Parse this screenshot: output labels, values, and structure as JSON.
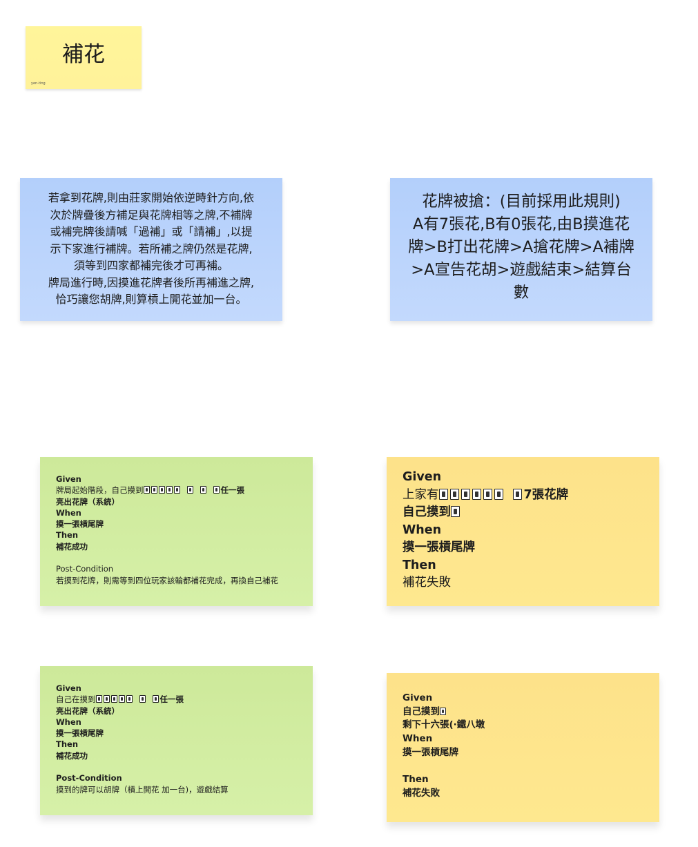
{
  "title_note": {
    "title": "補花",
    "author": "yen-ting"
  },
  "rule_notes": [
    {
      "lines": [
        "若拿到花牌,則由莊家開始依逆時針方向,依",
        "次於牌疊後方補足與花牌相等之牌,不補牌",
        "或補完牌後請喊「過補」或「請補」,以提",
        "示下家進行補牌。若所補之牌仍然是花牌,",
        "須等到四家都補完後才可再補。",
        "牌局進行時,因摸進花牌者後所再補進之牌,",
        "恰巧讓您胡牌,則算槓上開花並加一台。"
      ]
    },
    {
      "lines": [
        "花牌被搶：(目前採用此規則)",
        "A有7張花,B有0張花,由B摸進花",
        "牌>B打出花牌>A搶花牌>A補牌",
        ">A宣告花胡>遊戲結束>結算台",
        "數"
      ]
    }
  ],
  "gwt_notes": [
    {
      "given": "Given",
      "given_pre": "牌局起始階段，自己摸到",
      "given_post": "任一張",
      "given_2": "亮出花牌（系統）",
      "when": "When",
      "when_text": "摸一張槓尾牌",
      "then": "Then",
      "then_text": "補花成功",
      "post": "Post-Condition",
      "post_text": "若摸到花牌，則需等到四位玩家該輪都補花完成，再換自己補花"
    },
    {
      "given": "Given",
      "given_pre": "上家有",
      "given_post": "7張花牌",
      "given_2_pre": "自己摸到",
      "when": "When",
      "when_text": "摸一張槓尾牌",
      "then": "Then",
      "then_text": "補花失敗"
    },
    {
      "given": "Given",
      "given_pre": "自己在摸到",
      "given_post": "任一張",
      "given_2": "亮出花牌（系統）",
      "when": "When",
      "when_text": "摸一張槓尾牌",
      "then": "Then",
      "then_text": "補花成功",
      "post": "Post-Condition",
      "post_text": "摸到的牌可以胡牌（槓上開花 加一台)，遊戲結算"
    },
    {
      "given": "Given",
      "given_pre": "自己摸到",
      "given_2": "剩下十六張(·鐵八墩",
      "when": "When",
      "when_text": "摸一張槓尾牌",
      "then": "Then",
      "then_text": "補花失敗"
    }
  ]
}
